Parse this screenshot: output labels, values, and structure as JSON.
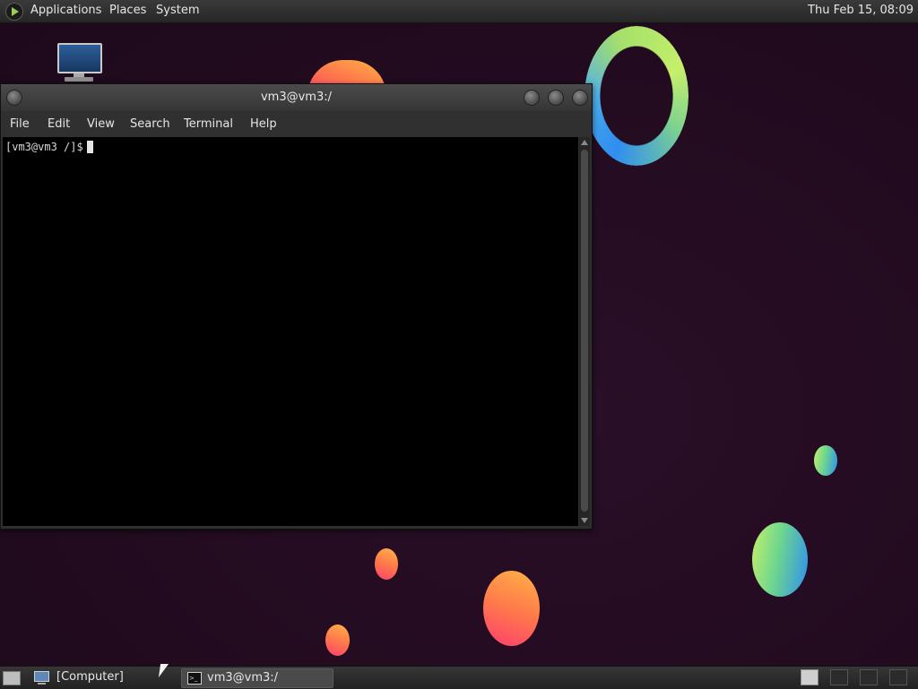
{
  "top_panel": {
    "menus": [
      "Applications",
      "Places",
      "System"
    ],
    "clock": "Thu Feb 15, 08:09"
  },
  "desktop": {
    "icons": [
      {
        "name": "computer-icon"
      }
    ]
  },
  "terminal_window": {
    "title": "vm3@vm3:/",
    "menus": [
      "File",
      "Edit",
      "View",
      "Search",
      "Terminal",
      "Help"
    ],
    "prompt": "[vm3@vm3 /]$"
  },
  "taskbar": {
    "tasks": [
      {
        "label": "[Computer]",
        "icon": "computer-icon",
        "active": false
      },
      {
        "label": "vm3@vm3:/",
        "icon": "terminal-icon",
        "active": true
      }
    ],
    "workspaces": 4,
    "active_workspace": 1
  },
  "colors": {
    "background": "#240c21",
    "terminal_bg": "#000000",
    "panel": "#2b2b2b"
  }
}
